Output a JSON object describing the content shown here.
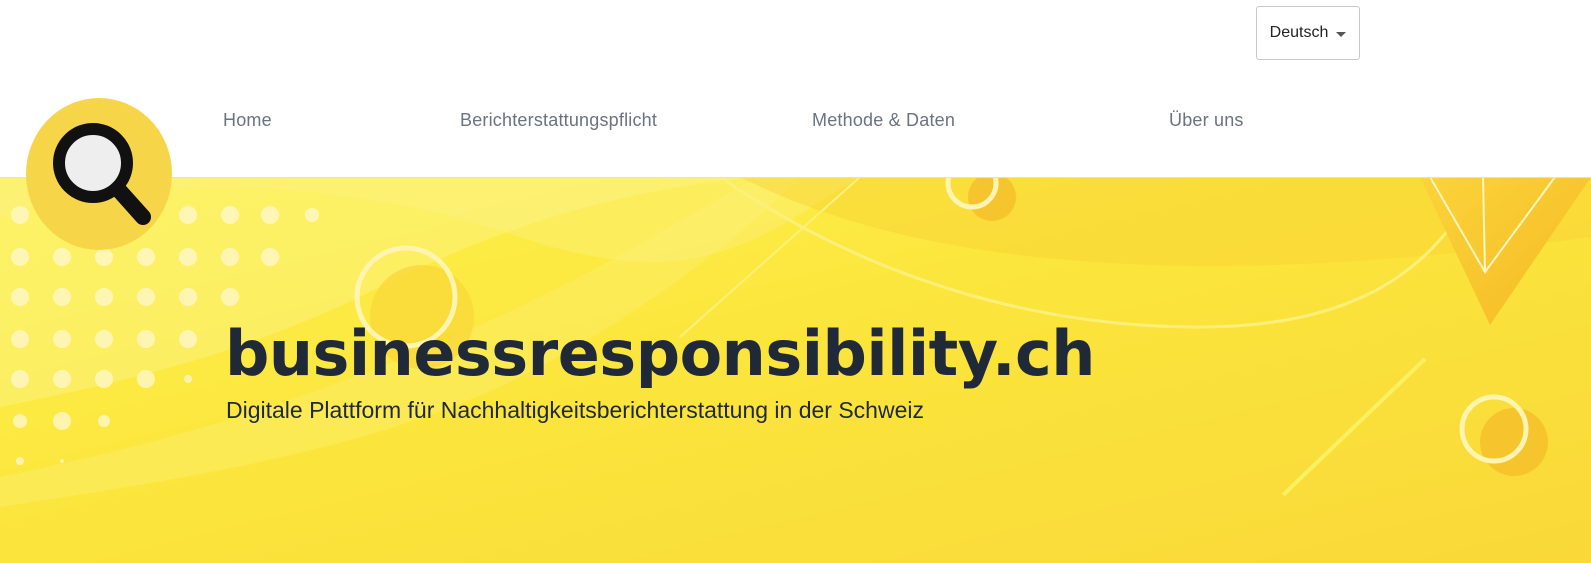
{
  "header": {
    "language_select": {
      "selected": "Deutsch",
      "icon": "chevron-down-icon"
    },
    "nav": [
      {
        "label": "Home"
      },
      {
        "label": "Berichterstattungspflicht"
      },
      {
        "label": "Methode & Daten"
      },
      {
        "label": "Über uns"
      }
    ],
    "logo": {
      "icon": "magnifier-icon",
      "accent": "#f6d648"
    }
  },
  "hero": {
    "title": "businessresponsibility.ch",
    "subtitle": "Digitale Plattform für Nachhaltigkeitsberichterstattung in der Schweiz",
    "background_color": "#fbe03d"
  }
}
